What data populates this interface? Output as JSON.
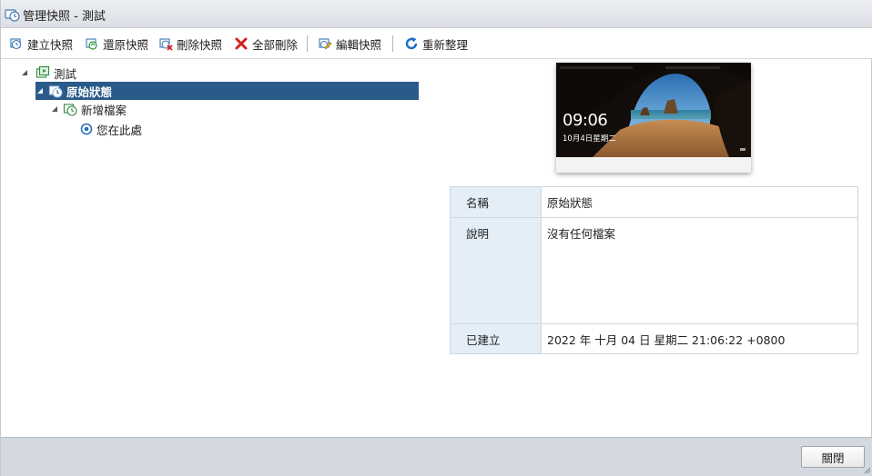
{
  "window": {
    "title": "管理快照 - 測試",
    "icon": "snapshot-manager-icon"
  },
  "toolbar": {
    "create_label": "建立快照",
    "revert_label": "還原快照",
    "delete_label": "刪除快照",
    "delete_all_label": "全部刪除",
    "edit_label": "編輯快照",
    "refresh_label": "重新整理"
  },
  "tree": {
    "root_label": "測試",
    "snapshot_label": "原始狀態",
    "child_label": "新增檔案",
    "current_label": "您在此處"
  },
  "preview": {
    "time": "09:06",
    "date": "10月4日星期二"
  },
  "details": {
    "name_key": "名稱",
    "name_value": "原始狀態",
    "description_key": "說明",
    "description_value": "沒有任何檔案",
    "created_key": "已建立",
    "created_value": "2022 年 十月 04 日 星期二 21:06:22 +0800"
  },
  "footer": {
    "close_label": "關閉"
  },
  "colors": {
    "selection": "#2a5a8a",
    "key_column": "#e3eef7",
    "footer": "#d4d9e1",
    "delete_red": "#d62020",
    "refresh_blue": "#1a6fc4"
  }
}
